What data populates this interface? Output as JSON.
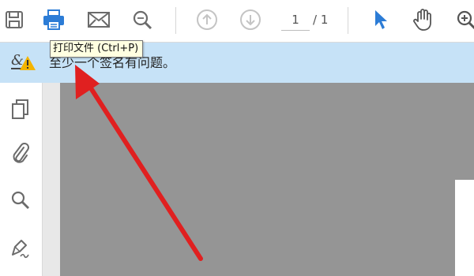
{
  "toolbar": {
    "page_current": "1",
    "page_total": "/ 1",
    "icons": [
      "save-icon",
      "print-icon",
      "email-icon",
      "zoom-search-icon",
      "previous-page-icon",
      "next-page-icon",
      "select-pointer-icon",
      "hand-tool-icon",
      "zoom-in-icon"
    ],
    "accent": "#2c7cd6"
  },
  "tooltip": {
    "text": "打印文件 (Ctrl+P)"
  },
  "signature_bar": {
    "message": "至少一个签名有问题。",
    "background": "#c6e2f7",
    "warning_color": "#f4b400"
  },
  "left_rail": {
    "icons": [
      "pages-icon",
      "attachment-icon",
      "search-icon",
      "sign-icon"
    ]
  },
  "annotation": {
    "color": "#e02020"
  }
}
